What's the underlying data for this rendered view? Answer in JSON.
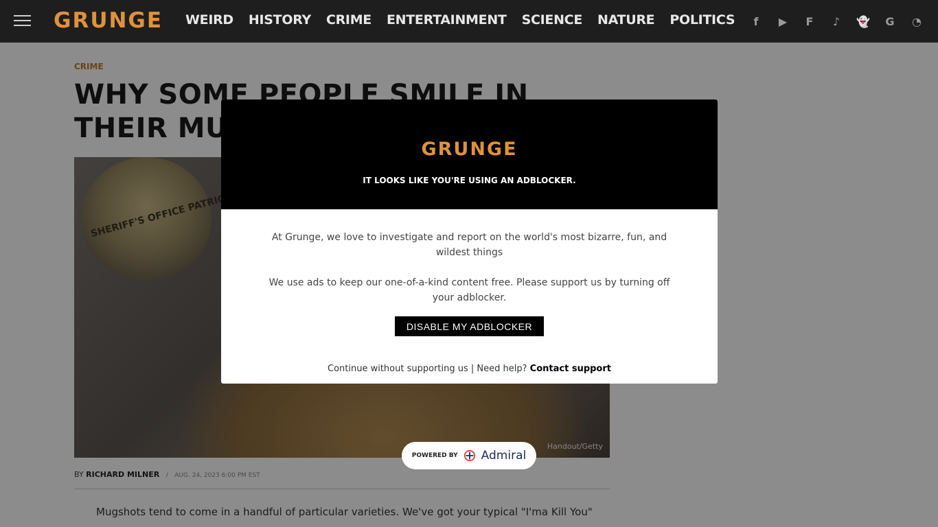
{
  "header": {
    "logo": "GRUNGE",
    "nav": [
      "WEIRD",
      "HISTORY",
      "CRIME",
      "ENTERTAINMENT",
      "SCIENCE",
      "NATURE",
      "POLITICS"
    ],
    "social_icons": [
      "facebook-icon",
      "youtube-icon",
      "flipboard-icon",
      "tiktok-icon",
      "snapchat-icon",
      "google-news-icon",
      "rss-icon"
    ],
    "social_glyphs": [
      "f",
      "▶",
      "F",
      "♪",
      "👻",
      "G",
      "◔"
    ]
  },
  "article": {
    "kicker": "CRIME",
    "title": "WHY SOME PEOPLE SMILE IN THEIR MUGSHOTS",
    "badge_text": "SHERIFF'S OFFICE PATRICK LABAT",
    "image_credit": "Handout/Getty",
    "byline_prefix": "BY",
    "author": "RICHARD MILNER",
    "separator": "/",
    "date": "AUG. 24, 2023 6:00 PM EST",
    "body_start": "Mugshots tend to come in a handful of particular varieties. We've got your typical \"I'ma Kill You\""
  },
  "modal": {
    "logo": "GRUNGE",
    "headline": "IT LOOKS LIKE YOU'RE USING AN ADBLOCKER.",
    "paragraph1": "At Grunge, we love to investigate and report on the world's most bizarre, fun, and wildest things",
    "paragraph2": "We use ads to keep our one-of-a-kind content free. Please support us by turning off your adblocker.",
    "button": "DISABLE MY ADBLOCKER",
    "continue_text": "Continue without supporting us",
    "divider": "|",
    "help_text": "Need help?",
    "contact_link": "Contact support"
  },
  "powered": {
    "label": "POWERED BY",
    "brand": "Admiral"
  },
  "colors": {
    "brand_orange": "#e0923a",
    "header_bg": "#1e1e1e"
  }
}
